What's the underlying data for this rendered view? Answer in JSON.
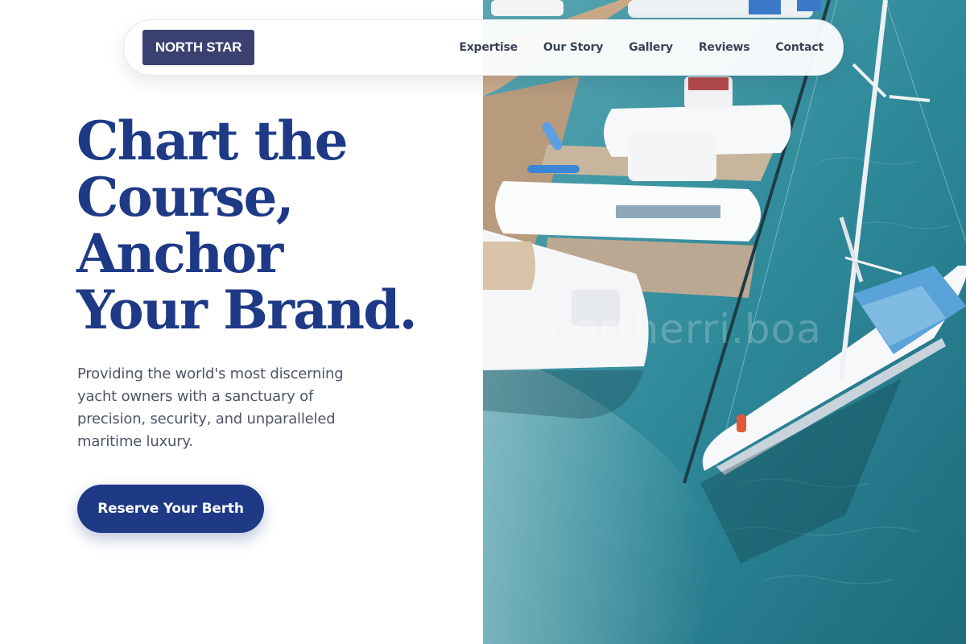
{
  "brand": {
    "logo_text": "NORTH STAR"
  },
  "nav": {
    "items": [
      {
        "label": "Expertise"
      },
      {
        "label": "Our Story"
      },
      {
        "label": "Gallery"
      },
      {
        "label": "Reviews"
      },
      {
        "label": "Contact"
      }
    ]
  },
  "hero": {
    "title_lines": [
      "Chart the",
      "Course,",
      "Anchor",
      "Your Brand."
    ],
    "subtitle": "Providing the world's most discerning yacht owners with a sanctuary of precision, security, and unparalleled maritime luxury.",
    "cta_label": "Reserve Your Berth"
  },
  "colors": {
    "accent": "#1e3a86",
    "logo_bg": "#3a4070",
    "water": "#2f8a9a"
  },
  "image": {
    "watermark": "northerri.boa"
  }
}
